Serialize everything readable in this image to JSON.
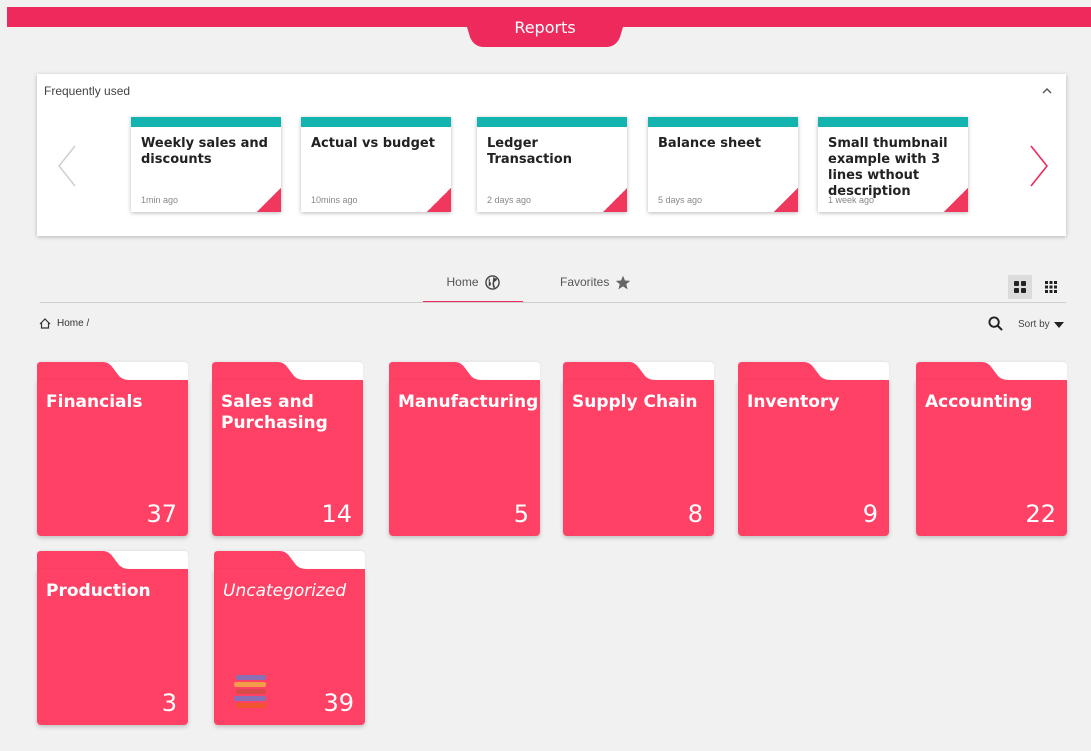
{
  "header": {
    "title": "Reports"
  },
  "frequently_used": {
    "title": "Frequently used",
    "collapse_icon": "chevron-up-icon",
    "cards": [
      {
        "title": "Weekly sales and discounts",
        "time": "1min ago"
      },
      {
        "title": "Actual vs budget",
        "time": "10mins ago"
      },
      {
        "title": "Ledger Transaction",
        "time": "2 days ago"
      },
      {
        "title": "Balance sheet",
        "time": "5 days ago"
      },
      {
        "title": "Small thumbnail example with 3 lines wthout description",
        "time": "1 week ago"
      }
    ]
  },
  "tabs": [
    {
      "label": "Home",
      "icon": "globe-icon",
      "active": true
    },
    {
      "label": "Favorites",
      "icon": "star-icon",
      "active": false
    }
  ],
  "breadcrumb": {
    "label": "Home /"
  },
  "sort": {
    "label": "Sort by"
  },
  "folders": [
    {
      "name": "Financials",
      "count": "37"
    },
    {
      "name": "Sales and Purchasing",
      "count": "14"
    },
    {
      "name": "Manufacturing",
      "count": "5"
    },
    {
      "name": "Supply Chain",
      "count": "8"
    },
    {
      "name": "Inventory",
      "count": "9"
    },
    {
      "name": "Accounting",
      "count": "22"
    },
    {
      "name": "Production",
      "count": "3"
    },
    {
      "name": "Uncategorized",
      "count": "39"
    }
  ],
  "colors": {
    "accent": "#ee2a5c",
    "folder": "#ff4165",
    "card_stripe": "#13b4b0",
    "background": "#f1f1f1"
  }
}
